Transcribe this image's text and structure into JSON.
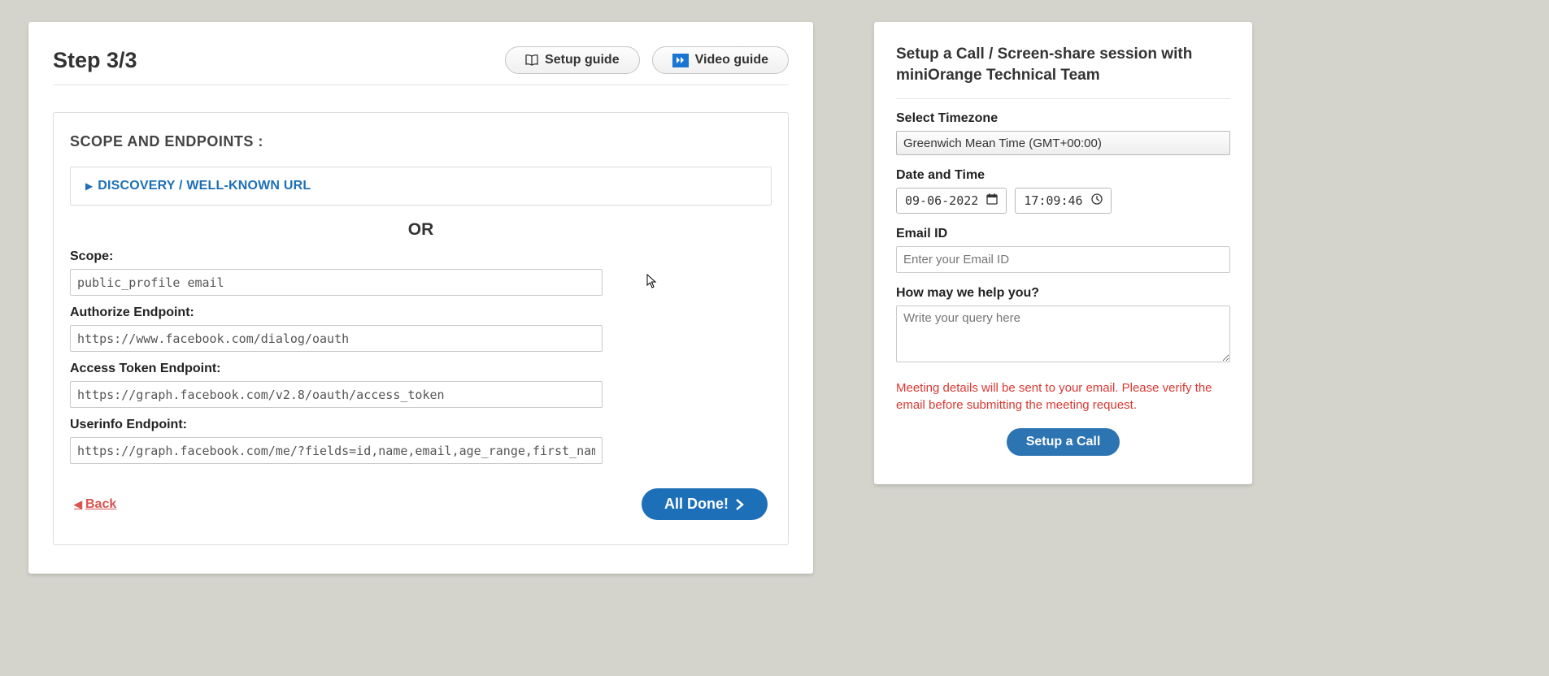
{
  "header": {
    "step_title": "Step 3/3",
    "setup_guide_label": "Setup guide",
    "video_guide_label": "Video guide"
  },
  "panel": {
    "title": "SCOPE AND ENDPOINTS :",
    "discovery_label": "DISCOVERY / WELL-KNOWN URL",
    "or_label": "OR",
    "scope_label": "Scope:",
    "scope_value": "public_profile email",
    "authorize_label": "Authorize Endpoint:",
    "authorize_value": "https://www.facebook.com/dialog/oauth",
    "access_token_label": "Access Token Endpoint:",
    "access_token_value": "https://graph.facebook.com/v2.8/oauth/access_token",
    "userinfo_label": "Userinfo Endpoint:",
    "userinfo_value": "https://graph.facebook.com/me/?fields=id,name,email,age_range,first_name,gender,last_name,lin",
    "back_label": "Back",
    "done_label": "All Done!"
  },
  "side": {
    "title": "Setup a Call / Screen-share session with miniOrange Technical Team",
    "timezone_label": "Select Timezone",
    "timezone_value": "Greenwich Mean Time (GMT+00:00)",
    "datetime_label": "Date and Time",
    "date_value": "09-06-2022",
    "time_value": "17:09:46",
    "email_label": "Email ID",
    "email_placeholder": "Enter your Email ID",
    "help_label": "How may we help you?",
    "help_placeholder": "Write your query here",
    "warn_text": "Meeting details will be sent to your email. Please verify the email before submitting the meeting request.",
    "call_button": "Setup a Call"
  }
}
